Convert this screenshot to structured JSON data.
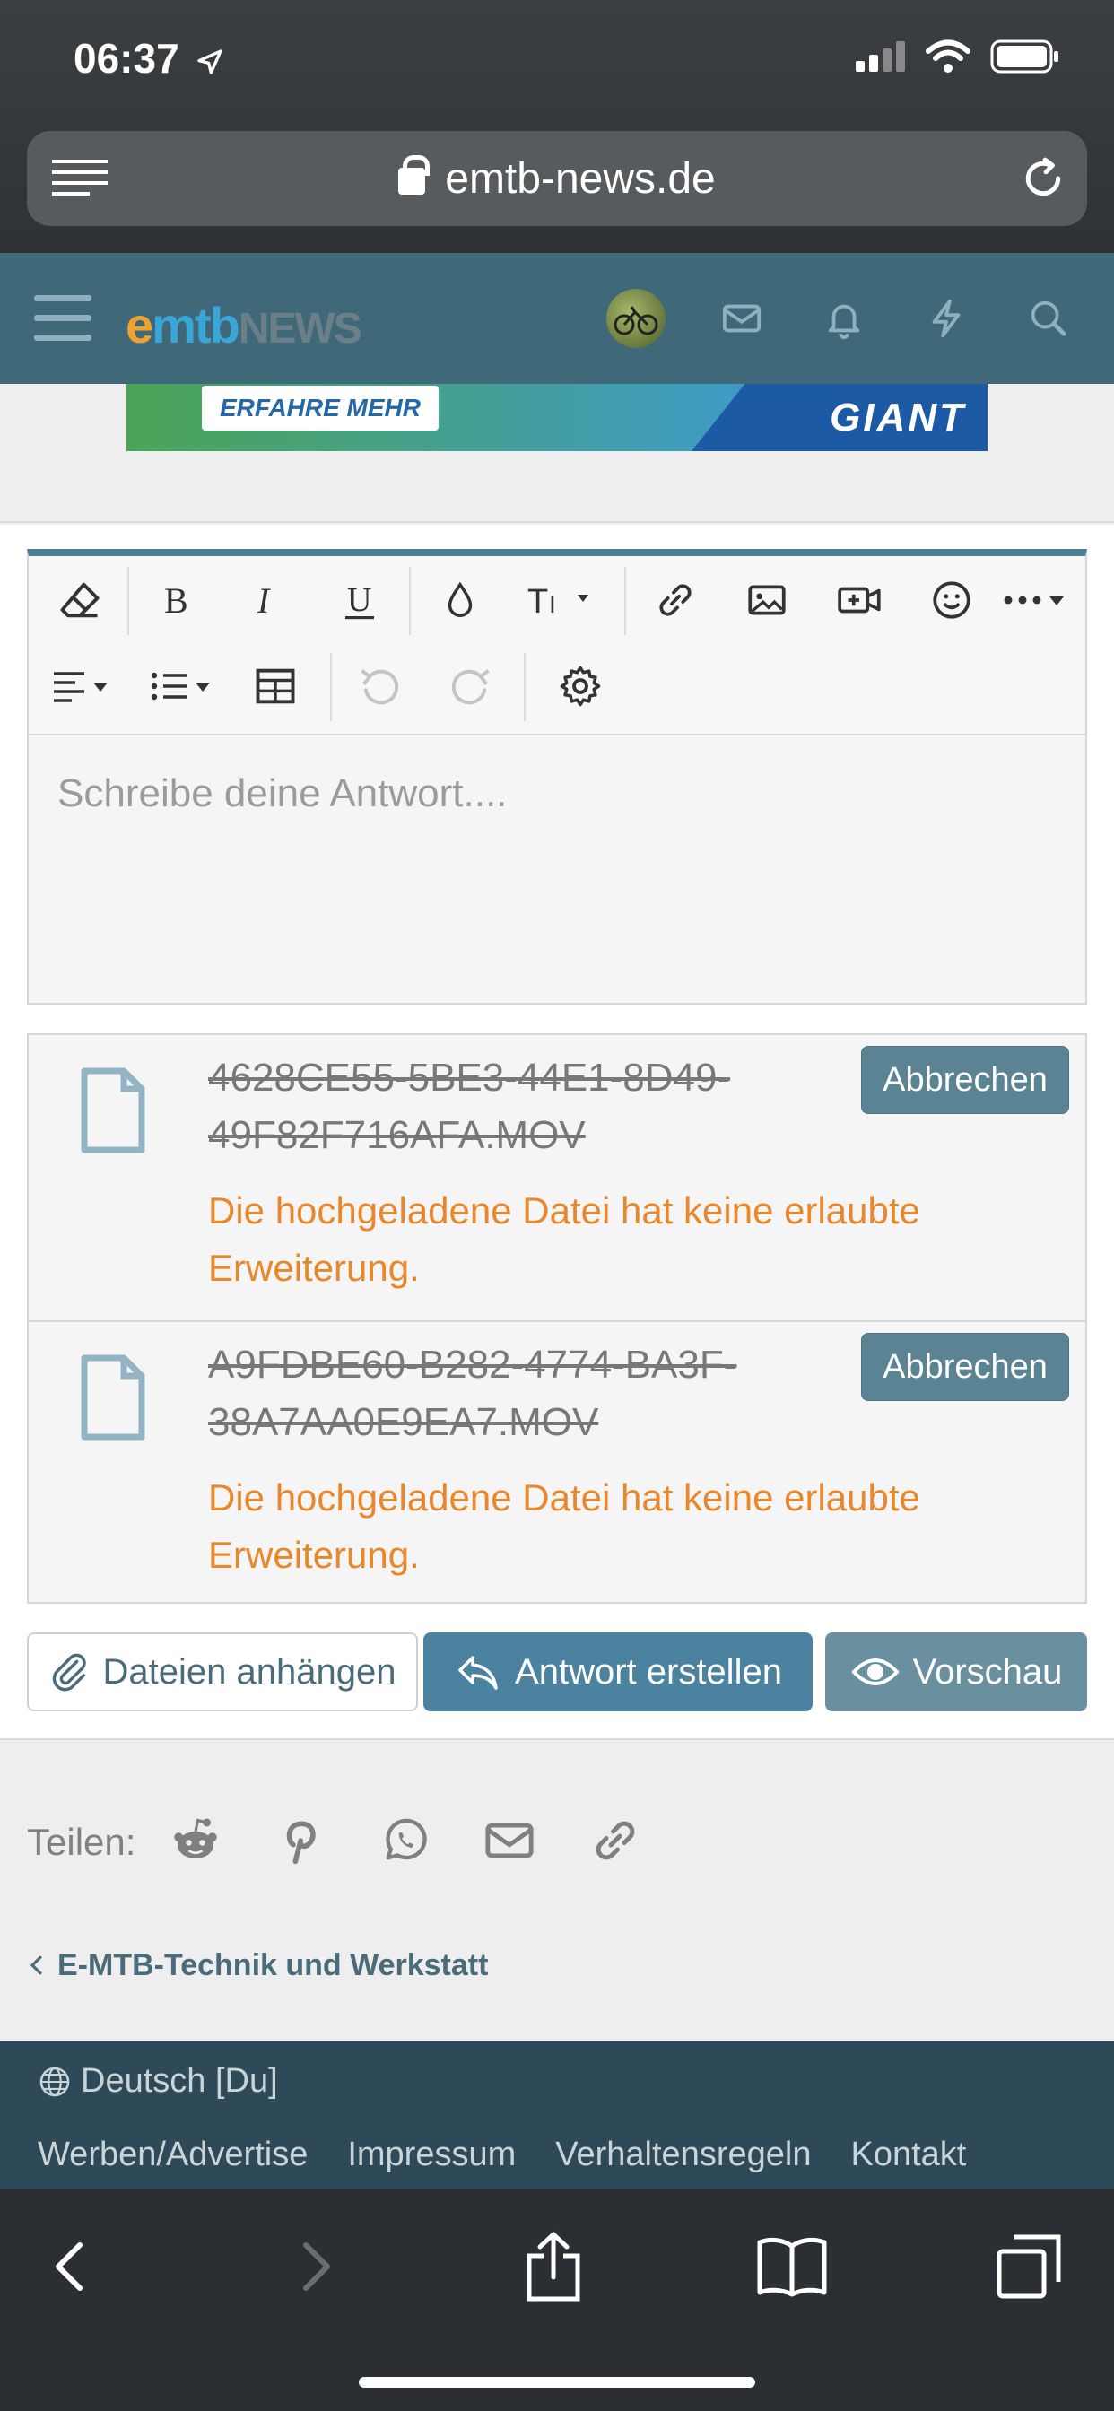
{
  "status": {
    "time": "06:37"
  },
  "browser": {
    "url": "emtb-news.de"
  },
  "header": {
    "logo_e": "e",
    "logo_mtb": "mtb",
    "logo_news": "NEWS"
  },
  "banner": {
    "cta": "ERFAHRE MEHR",
    "brand": "GIANT"
  },
  "editor": {
    "placeholder": "Schreibe deine Antwort...."
  },
  "attachments": [
    {
      "name": "4628CE55-5BE3-44E1-8D49-49F82F716AFA.MOV",
      "error": "Die hochgeladene Datei hat keine erlaubte Erweiterung.",
      "cancel_label": "Abbrechen"
    },
    {
      "name": "A9FDBE60-B282-4774-BA3F-38A7AA0E9EA7.MOV",
      "error": "Die hochgeladene Datei hat keine erlaubte Erweiterung.",
      "cancel_label": "Abbrechen"
    }
  ],
  "actions": {
    "attach_label": "Dateien anhängen",
    "reply_label": "Antwort erstellen",
    "preview_label": "Vorschau"
  },
  "share": {
    "label": "Teilen:"
  },
  "breadcrumb": {
    "label": "E-MTB-Technik und Werkstatt"
  },
  "footer": {
    "language": "Deutsch [Du]",
    "links": [
      "Werben/Advertise",
      "Impressum",
      "Verhaltensregeln",
      "Kontakt"
    ]
  },
  "colors": {
    "header": "#3f6878",
    "accent": "#4b82a0",
    "error": "#e8872b",
    "footer": "#2e4a58"
  }
}
